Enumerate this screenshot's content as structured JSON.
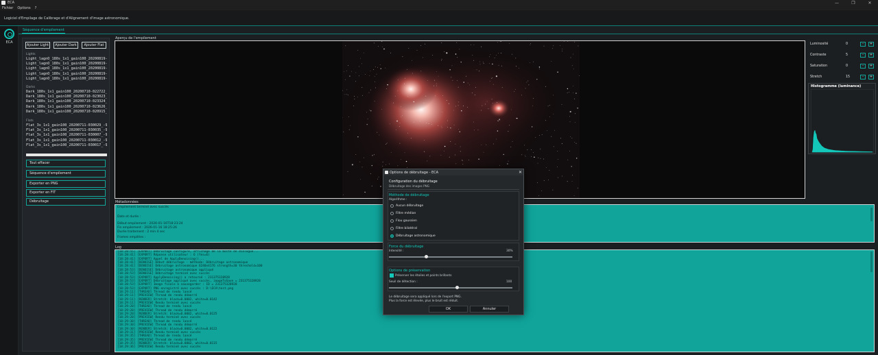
{
  "window": {
    "title": "ECA",
    "controls": [
      "—",
      "❐",
      "✕"
    ]
  },
  "menu": [
    "Fichier",
    "Options",
    "?"
  ],
  "header": {
    "subtitle": "Logiciel d'Empilage de Calibrage et d'Alignement d'image astronomique."
  },
  "sidebar": {
    "logo_label": "ECA"
  },
  "tabs": [
    {
      "label": "Séquence d'empilement"
    }
  ],
  "left": {
    "buttons": {
      "add_light": "Ajouter Light",
      "add_dark": "Ajouter Dark",
      "add_flat": "Ajouter Flat"
    },
    "lights_label": "Lights",
    "lights": [
      "Light_lagnO_180s_1x1_gain100_20200819-003",
      "Light_lagnO_180s_1x1_gain100_20200819-003",
      "Light_lagnO_180s_1x1_gain100_20200819-003",
      "Light_lagnO_180s_1x1_gain100_20200819-003",
      "Light_lagnO_180s_1x1_gain100_20200819-003"
    ],
    "darks_label": "Darks",
    "darks": [
      "Dark_180s_1x1_gain100_20200710-022722_-9",
      "Dark_180s_1x1_gain100_20200710-023023_-9",
      "Dark_180s_1x1_gain100_20200710-023324_-9",
      "Dark_180s_1x1_gain100_20200710-023626_-9",
      "Dark_180s_1x1_gain100_20200710-020915_-9"
    ],
    "flats_label": "Flats",
    "flats": [
      "Flat_3s_1x1_gain100_20200711-030029_-9.9C",
      "Flat_3s_1x1_gain100_20200711-030035_-9.9C",
      "Flat_3s_1x1_gain100_20200711-030007_-9.9C",
      "Flat_3s_1x1_gain100_20200711-030012_-9.9C",
      "Flat_3s_1x1_gain100_20200711-030017_-9.9C"
    ],
    "progress": 1.0,
    "actions": [
      "Tout effacer",
      "Séquence d'empilement",
      "Exporter en PNG",
      "Exporter en FIT",
      "Débruitage"
    ]
  },
  "preview": {
    "title": "Aperçu de l'empilement"
  },
  "adjust": [
    {
      "label": "Luminosité",
      "value": "0"
    },
    {
      "label": "Contraste",
      "value": "5"
    },
    {
      "label": "Saturation",
      "value": "0"
    },
    {
      "label": "Stretch",
      "value": "15"
    }
  ],
  "adjust_buttons": {
    "minus": "-",
    "plus": "+"
  },
  "histogram": {
    "title": "Histogramme (luminance)"
  },
  "metadata": {
    "title": "Métadonnées",
    "lines": [
      "Empilement terminé avec succès",
      "Date et durée :",
      "Début empilement : 2026-01-16T18:23:24",
      "Fin empilement : 2026-01-16 18:25:26",
      "Durée traitement : 2 min 4 sec",
      "Frames empilées :"
    ]
  },
  "log": {
    "title": "Log",
    "lines": [
      "[18:28:55] [EXPORT] Débruitage configuré, affichage de la boîte de dialogue...",
      "[18:28:41] [EXPORT] Réponse utilisateur : 6 (Yes=6)",
      "[18:28:41] [EXPORT] Appel de ApplyDenoising()...",
      "[18:28:41] [DENOISE] Début débruitage - méthode: Débruitage astronomique",
      "[18:28:41] [DENOISE] Débruitage astronomique 6240x4176 strength=30 threshold=100",
      "[18:28:53] [DENOISE] Débruitage astronomique appliqué",
      "[18:28:53] [DENOISE] Débruitage terminé avec succès",
      "[18:28:53] [EXPORT] ApplyDenoising() a retourné : 231375328928",
      "[18:28:53] [EXPORT] Débruitage appliqué avec succès, imageToSave = 231375328928",
      "[18:28:53] [EXPORT] Image finale à sauvegarder : ID = 231375328928",
      "[18:28:53] [EXPORT] PNG enregistré avec succès : D:\\ECA\\test.png",
      "[18:29:11] [THREAD] Thread de rendu lancé",
      "[18:29:11] [PREVIEW] Thread de rendu démarré",
      "[18:29:11] [RENDER] Stretch: black=0.0002, white=0.0142",
      "[18:29:11] [PREVIEW] Rendu terminé avec succès",
      "[18:29:20] [THREAD] Thread de rendu lancé",
      "[18:29:20] [PREVIEW] Thread de rendu démarré",
      "[18:29:20] [RENDER] Stretch: black=0.0002, white=0.0125",
      "[18:29:20] [PREVIEW] Rendu terminé avec succès",
      "[18:29:30] [THREAD] Thread de rendu lancé",
      "[18:29:30] [PREVIEW] Thread de rendu démarré",
      "[18:29:30] [RENDER] Stretch: black=0.0002, white=0.0122",
      "[18:29:31] [PREVIEW] Rendu terminé avec succès",
      "[18:29:35] [THREAD] Thread de rendu lancé",
      "[18:29:35] [PREVIEW] Thread de rendu démarré",
      "[18:29:35] [RENDER] Stretch: black=0.0002, white=0.0115",
      "[18:29:36] [PREVIEW] Rendu terminé avec succès"
    ]
  },
  "dialog": {
    "title": "Options de débruitage - ECA",
    "heading": "Configuration du débruitage",
    "subheading": "Débruitage des images PNG",
    "method_title": "Méthode de débruitage",
    "algo_label": "Algorithme :",
    "algorithms": [
      "Aucun débruitage",
      "Filtre médian",
      "Flou gaussien",
      "Filtre bilatéral",
      "Débruitage astronomique"
    ],
    "selected_algorithm": 4,
    "strength_title": "Force du débruitage",
    "intensity_label": "Intensité :",
    "intensity_value": "30%",
    "intensity": 0.3,
    "preserve_title": "Options de préservation",
    "preserve_label": "Préserver les étoiles et points brillants",
    "threshold_label": "Seuil de détection :",
    "threshold_value": "100",
    "threshold": 0.55,
    "note1": "Le débruitage sera appliqué lors de l'export PNG.",
    "note2": "Plus la force est élevée, plus le bruit est réduit.",
    "ok": "OK",
    "cancel": "Annuler"
  },
  "colors": {
    "accent": "#13c7b9",
    "panel": "#10a49b",
    "background": "#1c1f22"
  }
}
